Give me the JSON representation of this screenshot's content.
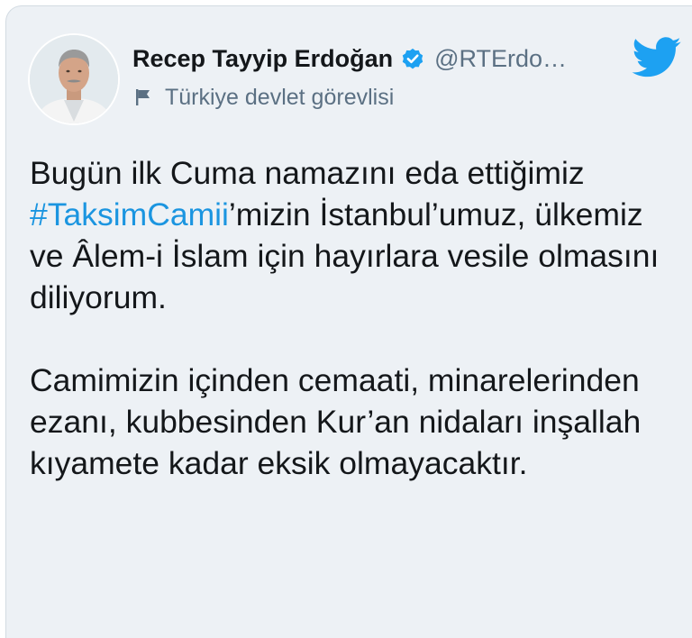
{
  "author": {
    "name": "Recep Tayyip Erdoğan",
    "handle": "@RTErdo…",
    "label": "Türkiye devlet görevlisi",
    "avatar_icon": "profile-photo",
    "verified_icon": "verified-badge-icon",
    "label_icon": "flag-icon"
  },
  "brand": {
    "icon": "twitter-bird-icon",
    "color": "#1da1f2"
  },
  "tweet": {
    "paragraph1": {
      "pre": "Bugün ilk Cuma namazını eda ettiğimiz ",
      "hashtag": "#TaksimCamii",
      "post": "’mizin İstanbul’umuz, ülkemiz ve Âlem-i İslam için hayırlara vesile olmasını diliyorum."
    },
    "paragraph2": "Camimizin içinden cemaati, minarelerinden ezanı, kubbesinden Kur’an nidaları inşallah kıyamete kadar eksik olmayacaktır."
  },
  "colors": {
    "background": "#edf1f5",
    "text": "#14171a",
    "secondary_text": "#5b7083",
    "link": "#1b95e0"
  }
}
